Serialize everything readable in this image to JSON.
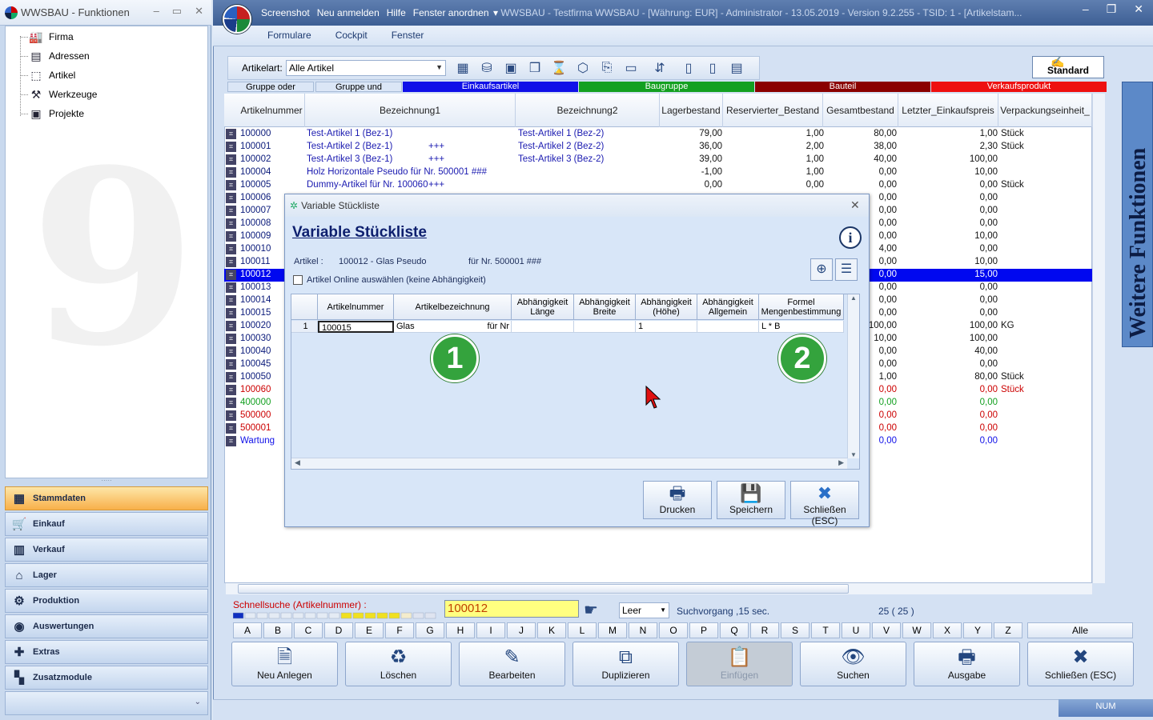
{
  "left_panel": {
    "title": "WWSBAU - Funktionen",
    "tree": [
      {
        "label": "Firma",
        "icon": "factory-icon"
      },
      {
        "label": "Adressen",
        "icon": "address-card-icon"
      },
      {
        "label": "Artikel",
        "icon": "box-icon"
      },
      {
        "label": "Werkzeuge",
        "icon": "tools-icon"
      },
      {
        "label": "Projekte",
        "icon": "project-icon"
      }
    ],
    "nav": [
      {
        "label": "Stammdaten",
        "icon": "stammdaten-icon",
        "active": true
      },
      {
        "label": "Einkauf",
        "icon": "cart-icon"
      },
      {
        "label": "Verkauf",
        "icon": "register-icon"
      },
      {
        "label": "Lager",
        "icon": "warehouse-icon"
      },
      {
        "label": "Produktion",
        "icon": "production-icon"
      },
      {
        "label": "Auswertungen",
        "icon": "chart-icon"
      },
      {
        "label": "Extras",
        "icon": "extras-icon"
      },
      {
        "label": "Zusatzmodule",
        "icon": "modules-icon"
      }
    ]
  },
  "app": {
    "menu": [
      "Screenshot",
      "Neu anmelden",
      "Hilfe",
      "Fenster anordnen"
    ],
    "title": "WWSBAU - Testfirma WWSBAU - [Währung: EUR] - Administrator - 13.05.2019 - Version 9.2.255 - TSID: 1 - [Artikelstam...",
    "submenu": [
      "Formulare",
      "Cockpit",
      "Fenster"
    ]
  },
  "toolbar": {
    "label": "Artikelart:",
    "select_value": "Alle Artikel",
    "standard_label": "Standard"
  },
  "legend": [
    {
      "label": "Gruppe oder",
      "color": "#dbe6f6",
      "text": "#000000"
    },
    {
      "label": "Gruppe und",
      "color": "#dbe6f6",
      "text": "#000000"
    },
    {
      "label": "Einkaufsartikel",
      "color": "#1010e8",
      "text": "#ffffff"
    },
    {
      "label": "Baugruppe",
      "color": "#13a020",
      "text": "#ffffff"
    },
    {
      "label": "Bauteil",
      "color": "#8a0000",
      "text": "#ffffff"
    },
    {
      "label": "Verkaufsprodukt",
      "color": "#ee1010",
      "text": "#ffffff"
    }
  ],
  "grid": {
    "columns": [
      "Artikelnummer",
      "Bezeichnung1",
      "Bezeichnung2",
      "Lagerbestand",
      "Reservierter_Bestand",
      "Gesamtbestand",
      "Letzter_Einkaufspreis",
      "Verpackungseinheit_"
    ],
    "rows": [
      {
        "nr": "100000",
        "b1": "Test-Artikel 1  (Bez-1)",
        "plus": "",
        "b2": "Test-Artikel 1  (Bez-2)",
        "lager": "79,00",
        "res": "1,00",
        "ges": "80,00",
        "ek": "1,00",
        "vpe": "Stück",
        "color": "#0a1a7a"
      },
      {
        "nr": "100001",
        "b1": "Test-Artikel 2  (Bez-1)",
        "plus": "+++",
        "b2": "Test-Artikel 2  (Bez-2)",
        "lager": "36,00",
        "res": "2,00",
        "ges": "38,00",
        "ek": "2,30",
        "vpe": "Stück",
        "color": "#0a1a7a"
      },
      {
        "nr": "100002",
        "b1": "Test-Artikel 3  (Bez-1)",
        "plus": "+++",
        "b2": "Test-Artikel 3  (Bez-2)",
        "lager": "39,00",
        "res": "1,00",
        "ges": "40,00",
        "ek": "100,00",
        "vpe": "",
        "color": "#0a1a7a"
      },
      {
        "nr": "100004",
        "b1": "Holz Horizontale Pseudo für Nr. 500001 ###",
        "plus": "",
        "b2": "",
        "lager": "-1,00",
        "res": "1,00",
        "ges": "0,00",
        "ek": "10,00",
        "vpe": "",
        "color": "#0a1a7a"
      },
      {
        "nr": "100005",
        "b1": "Dummy-Artikel für Nr. 100060",
        "plus": "+++",
        "b2": "",
        "lager": "0,00",
        "res": "0,00",
        "ges": "0,00",
        "ek": "0,00",
        "vpe": "Stück",
        "color": "#0a1a7a"
      },
      {
        "nr": "100006",
        "b1": "",
        "plus": "",
        "b2": "",
        "lager": "",
        "res": "",
        "ges": "0,00",
        "ek": "0,00",
        "vpe": "",
        "color": "#0a1a7a"
      },
      {
        "nr": "100007",
        "b1": "",
        "plus": "",
        "b2": "",
        "lager": "",
        "res": "",
        "ges": "0,00",
        "ek": "0,00",
        "vpe": "",
        "color": "#0a1a7a"
      },
      {
        "nr": "100008",
        "b1": "",
        "plus": "",
        "b2": "",
        "lager": "",
        "res": "",
        "ges": "0,00",
        "ek": "0,00",
        "vpe": "",
        "color": "#0a1a7a"
      },
      {
        "nr": "100009",
        "b1": "",
        "plus": "",
        "b2": "",
        "lager": "",
        "res": "",
        "ges": "0,00",
        "ek": "10,00",
        "vpe": "",
        "color": "#0a1a7a"
      },
      {
        "nr": "100010",
        "b1": "",
        "plus": "",
        "b2": "",
        "lager": "",
        "res": "",
        "ges": "4,00",
        "ek": "0,00",
        "vpe": "",
        "color": "#0a1a7a"
      },
      {
        "nr": "100011",
        "b1": "",
        "plus": "",
        "b2": "",
        "lager": "",
        "res": "",
        "ges": "0,00",
        "ek": "10,00",
        "vpe": "",
        "color": "#0a1a7a"
      },
      {
        "nr": "100012",
        "b1": "",
        "plus": "",
        "b2": "",
        "lager": "",
        "res": "",
        "ges": "0,00",
        "ek": "15,00",
        "vpe": "",
        "color": "#ffffff",
        "selected": true
      },
      {
        "nr": "100013",
        "b1": "",
        "plus": "",
        "b2": "",
        "lager": "",
        "res": "",
        "ges": "0,00",
        "ek": "0,00",
        "vpe": "",
        "color": "#0a1a7a"
      },
      {
        "nr": "100014",
        "b1": "",
        "plus": "",
        "b2": "",
        "lager": "",
        "res": "",
        "ges": "0,00",
        "ek": "0,00",
        "vpe": "",
        "color": "#0a1a7a"
      },
      {
        "nr": "100015",
        "b1": "",
        "plus": "",
        "b2": "",
        "lager": "",
        "res": "",
        "ges": "0,00",
        "ek": "0,00",
        "vpe": "",
        "color": "#0a1a7a"
      },
      {
        "nr": "100020",
        "b1": "",
        "plus": "",
        "b2": "",
        "lager": "",
        "res": "",
        "ges": "100,00",
        "ek": "100,00",
        "vpe": "KG",
        "color": "#0a1a7a"
      },
      {
        "nr": "100030",
        "b1": "",
        "plus": "",
        "b2": "",
        "lager": "",
        "res": "",
        "ges": "10,00",
        "ek": "100,00",
        "vpe": "",
        "color": "#0a1a7a"
      },
      {
        "nr": "100040",
        "b1": "",
        "plus": "",
        "b2": "",
        "lager": "",
        "res": "",
        "ges": "0,00",
        "ek": "40,00",
        "vpe": "",
        "color": "#0a1a7a"
      },
      {
        "nr": "100045",
        "b1": "",
        "plus": "",
        "b2": "",
        "lager": "",
        "res": "",
        "ges": "0,00",
        "ek": "0,00",
        "vpe": "",
        "color": "#0a1a7a"
      },
      {
        "nr": "100050",
        "b1": "",
        "plus": "",
        "b2": "",
        "lager": "",
        "res": "",
        "ges": "1,00",
        "ek": "80,00",
        "vpe": "Stück",
        "color": "#0a1a7a"
      },
      {
        "nr": "100060",
        "b1": "",
        "plus": "",
        "b2": "",
        "lager": "",
        "res": "",
        "ges": "0,00",
        "ek": "0,00",
        "vpe": "Stück",
        "color": "#cc0000"
      },
      {
        "nr": "400000",
        "b1": "",
        "plus": "",
        "b2": "",
        "lager": "",
        "res": "",
        "ges": "0,00",
        "ek": "0,00",
        "vpe": "",
        "color": "#13a020"
      },
      {
        "nr": "500000",
        "b1": "",
        "plus": "",
        "b2": "",
        "lager": "",
        "res": "",
        "ges": "0,00",
        "ek": "0,00",
        "vpe": "",
        "color": "#cc0000"
      },
      {
        "nr": "500001",
        "b1": "",
        "plus": "",
        "b2": "",
        "lager": "",
        "res": "",
        "ges": "0,00",
        "ek": "0,00",
        "vpe": "",
        "color": "#cc0000"
      },
      {
        "nr": "Wartung",
        "b1": "",
        "plus": "",
        "b2": "",
        "lager": "",
        "res": "",
        "ges": "0,00",
        "ek": "0,00",
        "vpe": "",
        "color": "#1010e8"
      }
    ]
  },
  "side_panel": {
    "label": "Weitere Funktionen"
  },
  "search": {
    "label": "Schnellsuche (Artikelnummer) :",
    "value": "100012",
    "mode": "Leer",
    "status": "Suchvorgang ,15 sec.",
    "count": "25  ( 25 )"
  },
  "alphabet": [
    "A",
    "B",
    "C",
    "D",
    "E",
    "F",
    "G",
    "H",
    "I",
    "J",
    "K",
    "L",
    "M",
    "N",
    "O",
    "P",
    "Q",
    "R",
    "S",
    "T",
    "U",
    "V",
    "W",
    "X",
    "Y",
    "Z"
  ],
  "alle_label": "Alle",
  "bottom_buttons": [
    {
      "label": "Neu Anlegen",
      "icon": "new-document-icon",
      "glyph": "🗎"
    },
    {
      "label": "Löschen",
      "icon": "recycle-bin-icon",
      "glyph": "♻"
    },
    {
      "label": "Bearbeiten",
      "icon": "edit-icon",
      "glyph": "✎"
    },
    {
      "label": "Duplizieren",
      "icon": "duplicate-icon",
      "glyph": "⧉"
    },
    {
      "label": "Einfügen",
      "icon": "paste-icon",
      "glyph": "📋",
      "disabled": true
    },
    {
      "label": "Suchen",
      "icon": "binoculars-icon",
      "glyph": "👁"
    },
    {
      "label": "Ausgabe",
      "icon": "printer-icon",
      "glyph": "🖶"
    },
    {
      "label": "Schließen (ESC)",
      "icon": "close-x-icon",
      "glyph": "✖"
    }
  ],
  "statusbar": {
    "num": "NUM"
  },
  "dialog": {
    "title": "Variable Stückliste",
    "heading": "Variable Stückliste",
    "artikel_label": "Artikel :",
    "artikel_value": "100012 - Glas Pseudo",
    "artikel_nr": "für Nr. 500001 ###",
    "checkbox_label": "Artikel Online auswählen (keine Abhängigkeit)",
    "columns": [
      "Artikelnummer",
      "Artikelbezeichnung",
      "Abhängigkeit Länge",
      "Abhängigkeit Breite",
      "Abhängigkeit (Höhe)",
      "Abhängigkeit Allgemein",
      "Formel Mengenbestimmung"
    ],
    "row": {
      "index": "1",
      "nr": "100015",
      "bez": "Glas",
      "bez_right": "für Nr",
      "laenge": "",
      "breite": "",
      "hoehe": "1",
      "allgemein": "",
      "formel": "L * B"
    },
    "markers": [
      "1",
      "2"
    ],
    "buttons": [
      {
        "label": "Drucken",
        "icon": "printer-icon",
        "glyph": "🖶"
      },
      {
        "label": "Speichern",
        "icon": "save-icon",
        "glyph": "💾"
      },
      {
        "label": "Schließen (ESC)",
        "icon": "close-x-icon",
        "glyph": "✖"
      }
    ]
  }
}
